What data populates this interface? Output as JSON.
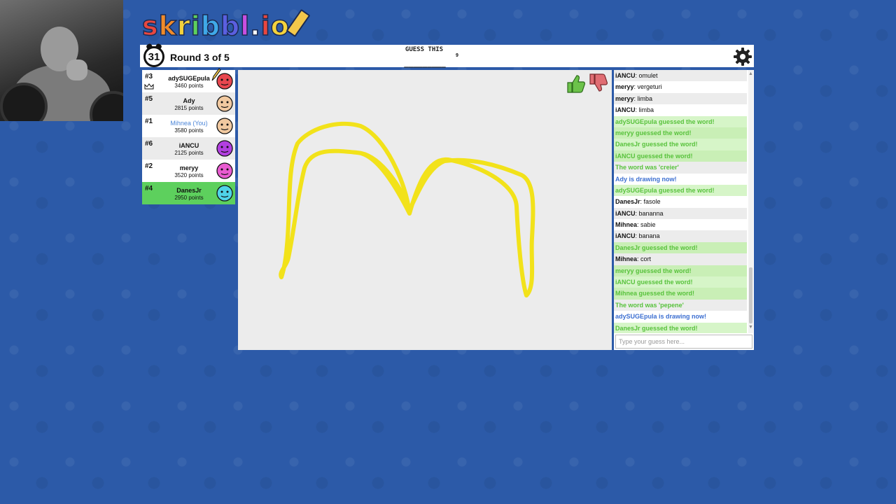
{
  "logo": {
    "letters": [
      {
        "ch": "s",
        "color": "#e8473f"
      },
      {
        "ch": "k",
        "color": "#f08b2a"
      },
      {
        "ch": "r",
        "color": "#f3d23c"
      },
      {
        "ch": "i",
        "color": "#5dd05d"
      },
      {
        "ch": "b",
        "color": "#3fa9e8"
      },
      {
        "ch": "b",
        "color": "#5b5fe0"
      },
      {
        "ch": "l",
        "color": "#c94fe0"
      },
      {
        "ch": ".",
        "color": "#ffffff"
      },
      {
        "ch": "i",
        "color": "#e8473f"
      },
      {
        "ch": "o",
        "color": "#f3d23c"
      }
    ]
  },
  "header": {
    "timer": "31",
    "round": "Round 3 of 5",
    "guess_label": "GUESS THIS",
    "word_blanks": "_________",
    "word_length": "9"
  },
  "players": [
    {
      "rank": "#3",
      "name": "adySUGEpula",
      "points": "3460 points",
      "avatar_color": "#e8474f",
      "drawing": true,
      "owner": true,
      "style": "white"
    },
    {
      "rank": "#5",
      "name": "Ady",
      "points": "2815 points",
      "avatar_color": "#f1c9a0",
      "style": "alt"
    },
    {
      "rank": "#1",
      "name": "Mihnea (You)",
      "points": "3580 points",
      "avatar_color": "#f1c9a0",
      "you": true,
      "style": "white"
    },
    {
      "rank": "#6",
      "name": "iANCU",
      "points": "2125 points",
      "avatar_color": "#b23fe0",
      "style": "alt"
    },
    {
      "rank": "#2",
      "name": "meryy",
      "points": "3520 points",
      "avatar_color": "#e85bd0",
      "style": "white"
    },
    {
      "rank": "#4",
      "name": "DanesJr",
      "points": "2950 points",
      "avatar_color": "#4fd3e8",
      "style": "guessed"
    }
  ],
  "chat": {
    "messages": [
      {
        "user": "iANCU",
        "text": "omulet",
        "kind": "normal"
      },
      {
        "user": "meryy",
        "text": "vergeturi",
        "kind": "normal"
      },
      {
        "user": "meryy",
        "text": "limba",
        "kind": "normal"
      },
      {
        "user": "iANCU",
        "text": "limba",
        "kind": "normal"
      },
      {
        "text": "adySUGEpula guessed the word!",
        "kind": "good"
      },
      {
        "text": "meryy guessed the word!",
        "kind": "good"
      },
      {
        "text": "DanesJr guessed the word!",
        "kind": "good"
      },
      {
        "text": "iANCU guessed the word!",
        "kind": "good"
      },
      {
        "text": "The word was 'creier'",
        "kind": "info"
      },
      {
        "text": "Ady is drawing now!",
        "kind": "blue"
      },
      {
        "text": "adySUGEpula guessed the word!",
        "kind": "good"
      },
      {
        "user": "DanesJr",
        "text": "fasole",
        "kind": "normal"
      },
      {
        "user": "iANCU",
        "text": "bananna",
        "kind": "normal"
      },
      {
        "user": "Mihnea",
        "text": "sabie",
        "kind": "normal"
      },
      {
        "user": "iANCU",
        "text": "banana",
        "kind": "normal"
      },
      {
        "text": "DanesJr guessed the word!",
        "kind": "good"
      },
      {
        "user": "Mihnea",
        "text": "cort",
        "kind": "normal"
      },
      {
        "text": "meryy guessed the word!",
        "kind": "good"
      },
      {
        "text": "iANCU guessed the word!",
        "kind": "good"
      },
      {
        "text": "Mihnea guessed the word!",
        "kind": "good"
      },
      {
        "text": "The word was 'pepene'",
        "kind": "info"
      },
      {
        "text": "adySUGEpula is drawing now!",
        "kind": "blue"
      },
      {
        "text": "DanesJr guessed the word!",
        "kind": "good"
      }
    ],
    "input_placeholder": "Type your guess here..."
  },
  "colors": {
    "background": "#2c5aa8",
    "stroke": "#f2e21a",
    "guessed": "#5dd05d",
    "you": "#4c86d8"
  }
}
